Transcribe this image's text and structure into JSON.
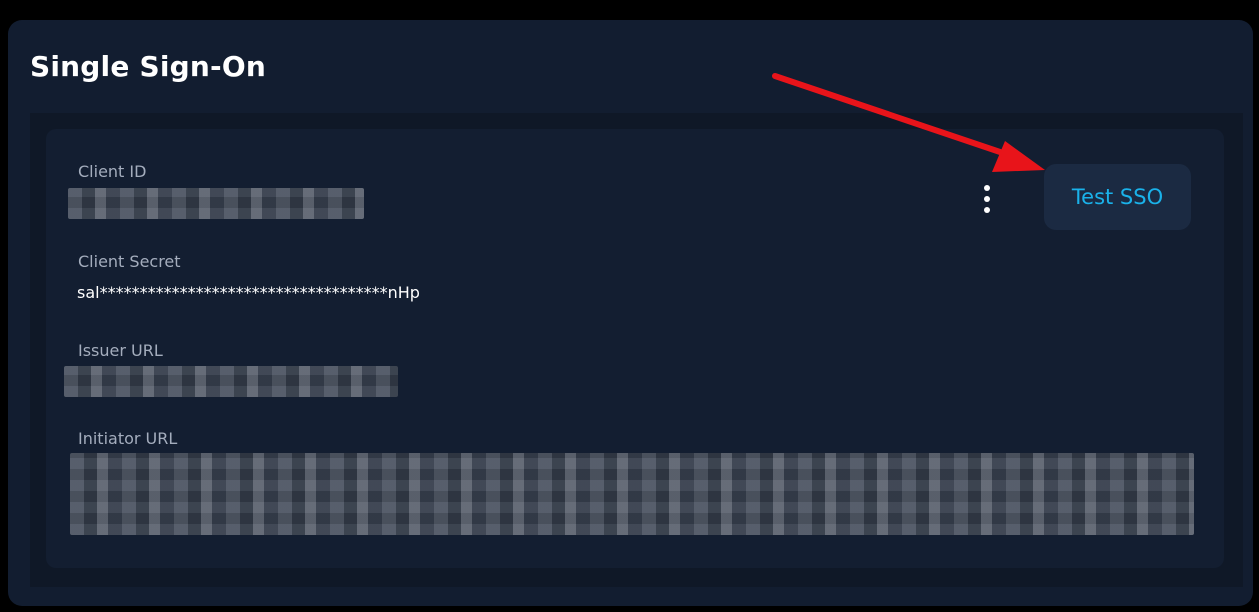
{
  "panel": {
    "title": "Single Sign-On"
  },
  "fields": {
    "client_id": {
      "label": "Client ID"
    },
    "client_secret": {
      "label": "Client Secret",
      "value": "sal************************************nHp"
    },
    "issuer_url": {
      "label": "Issuer URL"
    },
    "initiator_url": {
      "label": "Initiator URL"
    }
  },
  "actions": {
    "more_icon": "vertical-ellipsis-icon",
    "test_sso_label": "Test SSO"
  },
  "colors": {
    "background": "#000000",
    "panel": "#121d30",
    "card": "#131e31",
    "accent": "#1ab2ea",
    "annotation_arrow": "#e8141a"
  }
}
